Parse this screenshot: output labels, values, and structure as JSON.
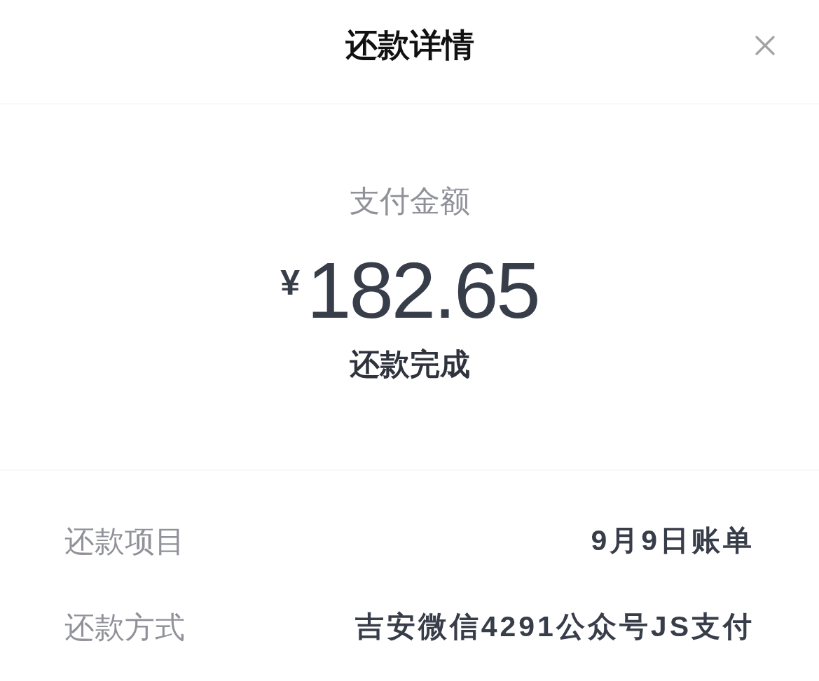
{
  "header": {
    "title": "还款详情"
  },
  "summary": {
    "label": "支付金额",
    "currency": "¥",
    "amount": "182.65",
    "status": "还款完成"
  },
  "details": [
    {
      "label": "还款项目",
      "value": "9月9日账单"
    },
    {
      "label": "还款方式",
      "value": "吉安微信4291公众号JS支付"
    }
  ]
}
